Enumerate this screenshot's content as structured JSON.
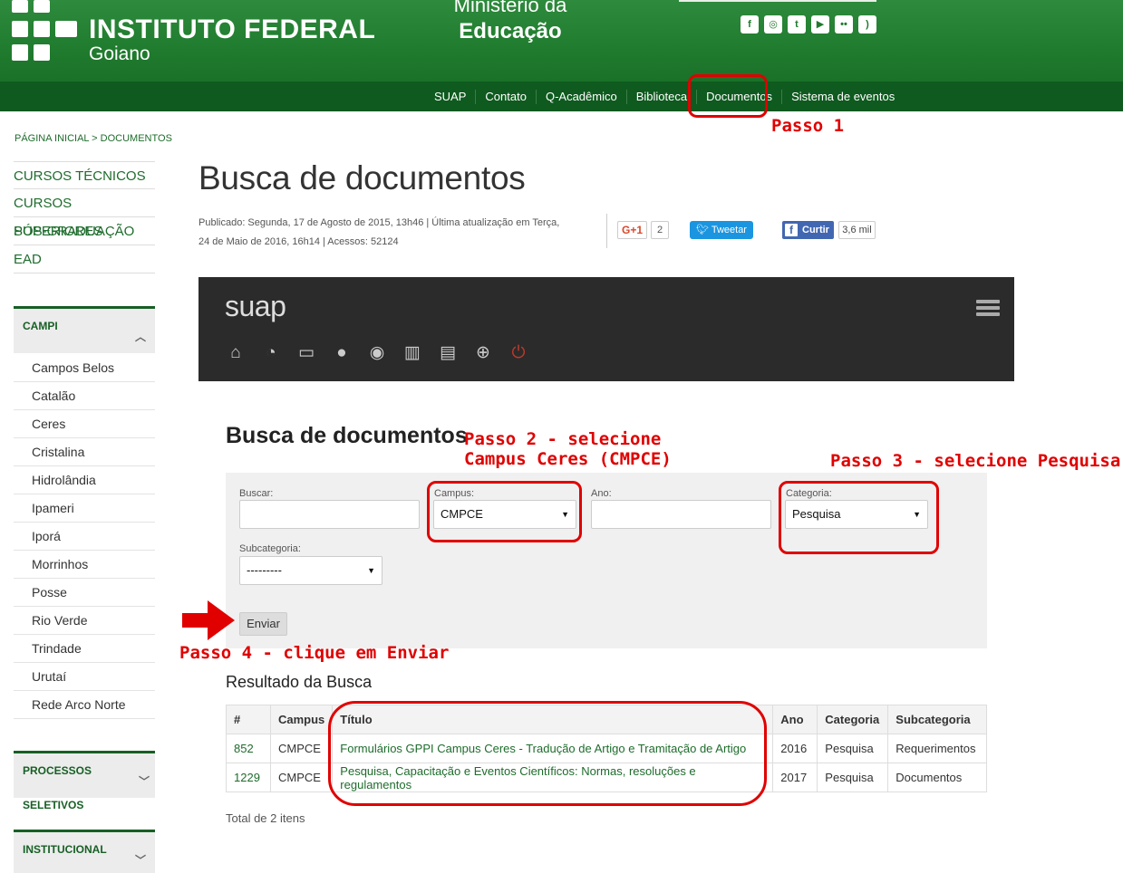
{
  "header": {
    "brand_title": "INSTITUTO FEDERAL",
    "brand_sub": "Goiano",
    "ministry_top": "Ministério da",
    "ministry_bottom": "Educação",
    "social_icons": [
      "facebook-icon",
      "instagram-icon",
      "twitter-icon",
      "youtube-icon",
      "flickr-icon",
      "rss-icon"
    ]
  },
  "nav": {
    "items": [
      "SUAP",
      "Contato",
      "Q-Acadêmico",
      "Biblioteca",
      "Documentos",
      "Sistema de eventos"
    ]
  },
  "breadcrumb": "PÁGINA INICIAL > DOCUMENTOS",
  "sidebar": {
    "top_links": [
      "CURSOS TÉCNICOS",
      "CURSOS SUPERIORES",
      "PÓS-GRADUAÇÃO",
      "EAD"
    ],
    "campi_title": "CAMPI",
    "campi": [
      "Campos Belos",
      "Catalão",
      "Ceres",
      "Cristalina",
      "Hidrolândia",
      "Ipameri",
      "Iporá",
      "Morrinhos",
      "Posse",
      "Rio Verde",
      "Trindade",
      "Urutaí",
      "Rede Arco Norte"
    ],
    "processos_title": "PROCESSOS SELETIVOS",
    "institucional_title": "INSTITUCIONAL"
  },
  "main": {
    "title": "Busca de documentos",
    "meta_line1": "Publicado: Segunda, 17 de Agosto de 2015, 13h46 | Última atualização em Terça,",
    "meta_line2": "24 de Maio de 2016, 16h14 | Acessos: 52124",
    "share": {
      "gplus_label": "G+1",
      "gplus_count": "2",
      "tweet_label": "Tweetar",
      "fb_label": "Curtir",
      "fb_count": "3,6 mil"
    }
  },
  "suap": {
    "logo": "suap",
    "icons": [
      "home-icon",
      "pie-chart-icon",
      "monitor-icon",
      "user-icon",
      "compass-icon",
      "bar-chart-icon",
      "briefcase-icon",
      "globe-icon",
      "power-icon"
    ]
  },
  "search": {
    "title": "Busca de documentos",
    "buscar_label": "Buscar:",
    "campus_label": "Campus:",
    "campus_value": "CMPCE",
    "ano_label": "Ano:",
    "categoria_label": "Categoria:",
    "categoria_value": "Pesquisa",
    "subcategoria_label": "Subcategoria:",
    "subcategoria_value": "---------",
    "submit_label": "Enviar"
  },
  "results": {
    "title": "Resultado da Busca",
    "columns": [
      "#",
      "Campus",
      "Título",
      "Ano",
      "Categoria",
      "Subcategoria"
    ],
    "rows": [
      [
        "852",
        "CMPCE",
        "Formulários GPPI Campus Ceres - Tradução de Artigo e Tramitação de Artigo",
        "2016",
        "Pesquisa",
        "Requerimentos"
      ],
      [
        "1229",
        "CMPCE",
        "Pesquisa, Capacitação e Eventos Científicos: Normas, resoluções e regulamentos",
        "2017",
        "Pesquisa",
        "Documentos"
      ]
    ],
    "total": "Total de 2 itens"
  },
  "annotations": {
    "step1": "Passo 1",
    "step2_line1": "Passo 2 - selecione",
    "step2_line2": "Campus Ceres (CMPCE)",
    "step3": "Passo 3 - selecione Pesquisa",
    "step4": "Passo 4 - clique em Enviar",
    "color": "#e00000"
  }
}
